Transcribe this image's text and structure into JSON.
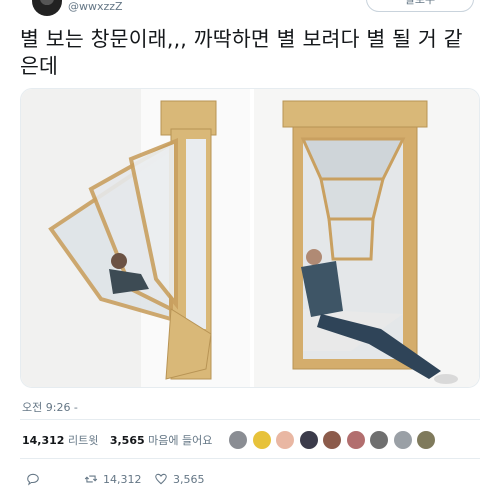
{
  "header": {
    "handle": "@wwxzzZ",
    "follow_label": "팔로우"
  },
  "tweet": {
    "text": "별 보는 창문이래,,, 까딱하면 별 보려다 별 될 거 같은데",
    "timestamp": "오전 9:26 -"
  },
  "stats": {
    "retweets_count": "14,312",
    "retweets_label": "리트윗",
    "likes_count": "3,565",
    "likes_label": "마음에 들어요"
  },
  "likers": [
    {
      "icon": "avatar-gray",
      "color": "#8a8d93"
    },
    {
      "icon": "avatar-cartoon-yellow",
      "color": "#e7c23a"
    },
    {
      "icon": "avatar-peach",
      "color": "#e9b7a3"
    },
    {
      "icon": "avatar-dark",
      "color": "#3b3b4a"
    },
    {
      "icon": "avatar-brown",
      "color": "#8c5b4b"
    },
    {
      "icon": "avatar-rose",
      "color": "#b26e6e"
    },
    {
      "icon": "avatar-bird",
      "color": "#6f6f6f"
    },
    {
      "icon": "avatar-grayish",
      "color": "#9aa0a6"
    },
    {
      "icon": "avatar-olive",
      "color": "#7f7a5c"
    }
  ],
  "actions": {
    "reply_icon": "reply-icon",
    "retweet_icon": "retweet-icon",
    "retweet_count": "14,312",
    "like_icon": "heart-icon",
    "like_count": "3,565"
  },
  "colors": {
    "text_primary": "#14171a",
    "text_secondary": "#657786",
    "divider": "#e6ecf0",
    "wood": "#d9b878"
  }
}
